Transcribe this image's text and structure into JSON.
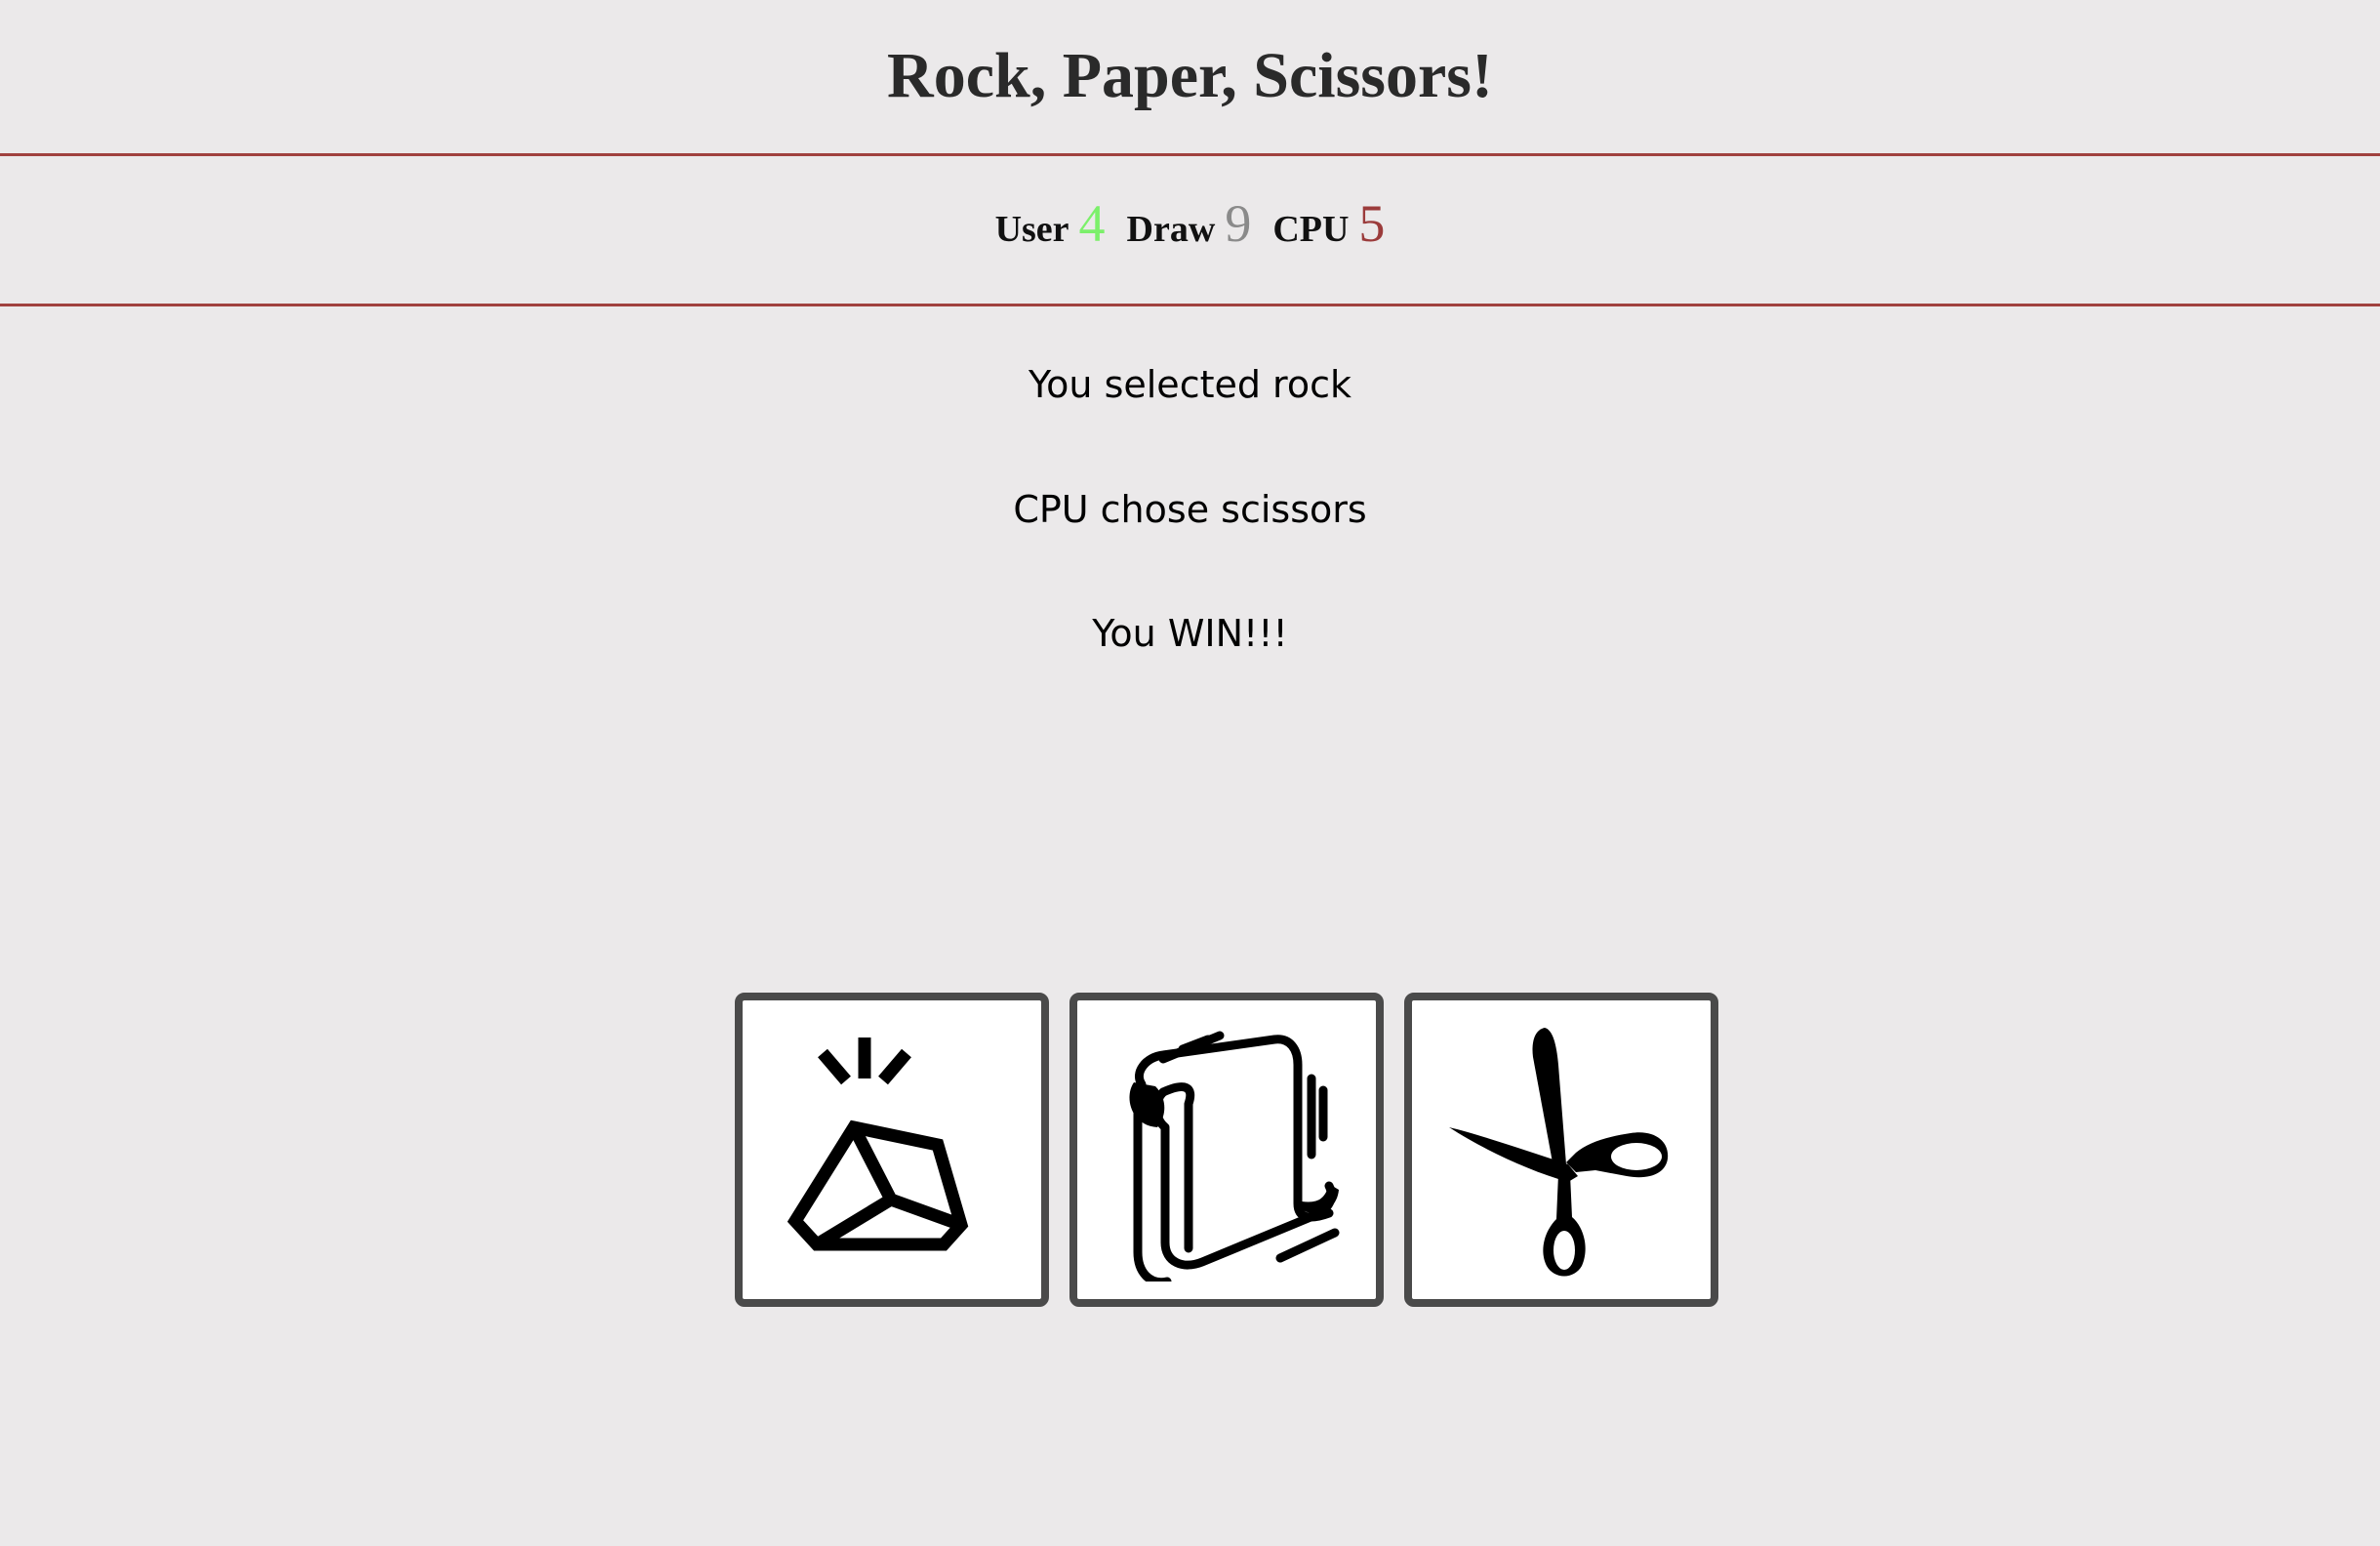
{
  "header": {
    "title": "Rock, Paper, Scissors!"
  },
  "scoreboard": {
    "user_label": "User",
    "user_score": "4",
    "draw_label": "Draw",
    "draw_score": "9",
    "cpu_label": "CPU",
    "cpu_score": "5"
  },
  "result": {
    "user_selection": "You selected rock",
    "cpu_selection": "CPU chose scissors",
    "outcome": "You WIN!!!"
  },
  "choices": [
    {
      "name": "rock",
      "icon": "rock-icon"
    },
    {
      "name": "paper",
      "icon": "paper-scroll-icon"
    },
    {
      "name": "scissors",
      "icon": "scissors-icon"
    }
  ],
  "colors": {
    "background": "#ebe9ea",
    "rule": "#a0413e",
    "user_score": "#7cf06b",
    "draw_score": "#8a8a8a",
    "cpu_score": "#9b3b3b",
    "button_border": "#4a4a4a"
  }
}
